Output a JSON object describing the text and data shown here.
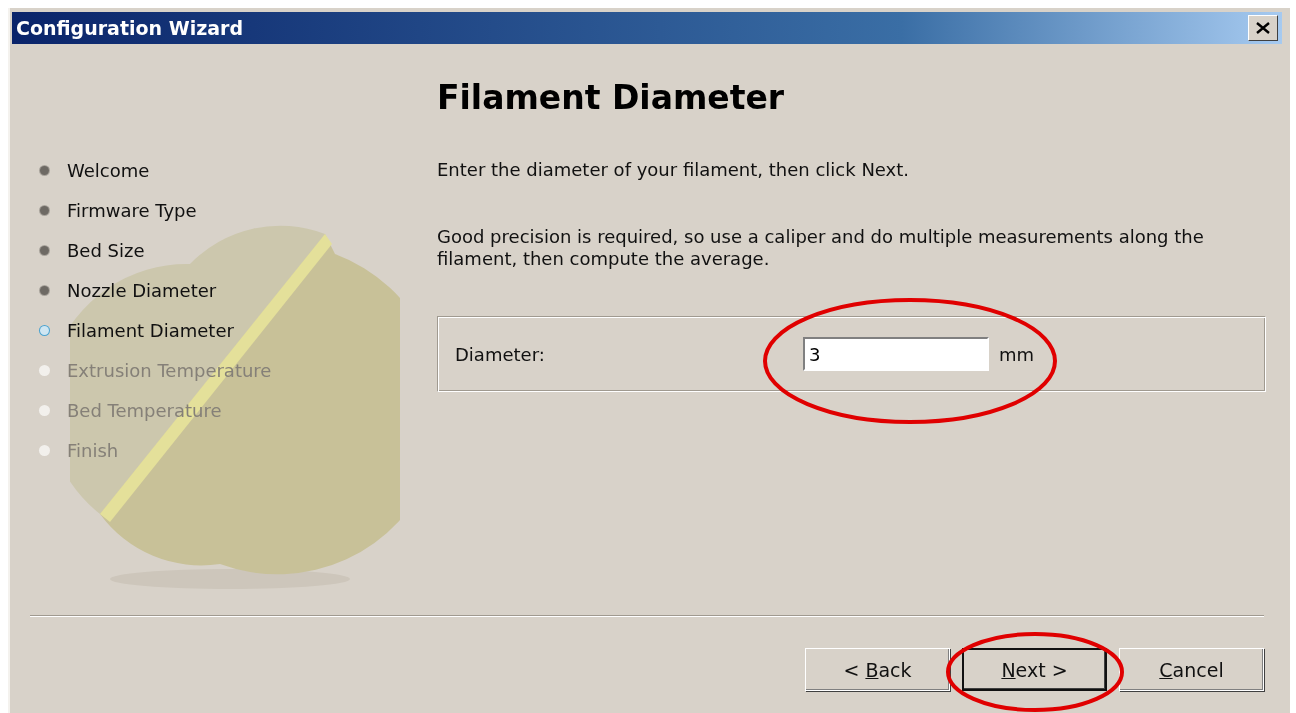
{
  "window": {
    "title": "Configuration Wizard"
  },
  "steps": [
    {
      "label": "Welcome",
      "done": true,
      "selected": false
    },
    {
      "label": "Firmware Type",
      "done": true,
      "selected": false
    },
    {
      "label": "Bed Size",
      "done": true,
      "selected": false
    },
    {
      "label": "Nozzle Diameter",
      "done": true,
      "selected": false
    },
    {
      "label": "Filament Diameter",
      "done": false,
      "selected": true
    },
    {
      "label": "Extrusion Temperature",
      "done": false,
      "selected": false
    },
    {
      "label": "Bed Temperature",
      "done": false,
      "selected": false
    },
    {
      "label": "Finish",
      "done": false,
      "selected": false
    }
  ],
  "heading": "Filament Diameter",
  "paragraphs": [
    "Enter the diameter of your filament, then click Next.",
    "Good precision is required, so use a caliper and do multiple measurements along the filament, then compute the average."
  ],
  "field": {
    "label": "Diameter:",
    "value": "3",
    "unit": "mm"
  },
  "buttons": [
    {
      "pre": "< ",
      "key": "B",
      "post": "ack",
      "default": false
    },
    {
      "key": "N",
      "post": "ext >",
      "default": true
    },
    {
      "key": "C",
      "post": "ancel",
      "default": false
    }
  ],
  "annotations": [
    {
      "kind": "ellipse"
    },
    {
      "kind": "ellipse"
    }
  ]
}
